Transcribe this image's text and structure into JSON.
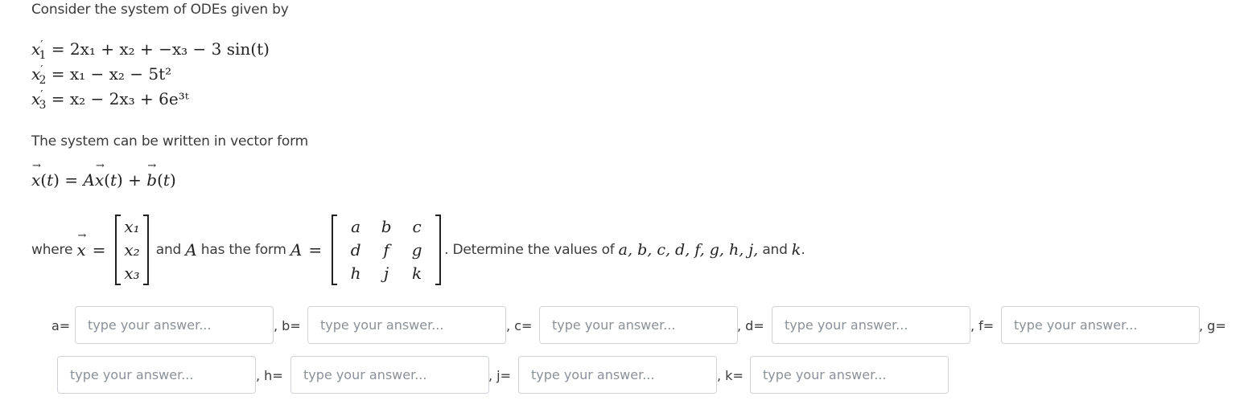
{
  "intro": "Consider the system of ODEs given by",
  "equations": [
    {
      "lhs_var": "x",
      "lhs_sub": "1",
      "rhs": "= 2x₁ + x₂ + −x₃ − 3 sin(t)"
    },
    {
      "lhs_var": "x",
      "lhs_sub": "2",
      "rhs": "= x₁ − x₂ − 5t²"
    },
    {
      "lhs_var": "x",
      "lhs_sub": "3",
      "rhs": "= x₂ − 2x₃ + 6e³ᵗ"
    }
  ],
  "vector_intro": "The system can be written in vector form",
  "vector_equation": "x(t) = Ax(t) + b(t)",
  "where_text": {
    "where": "where",
    "x_vec": "x",
    "equals": "=",
    "x_entries": [
      "x₁",
      "x₂",
      "x₃"
    ],
    "and_text": "and",
    "A": "A",
    "has_form": "has the form",
    "A_entries": [
      [
        "a",
        "b",
        "c"
      ],
      [
        "d",
        "f",
        "g"
      ],
      [
        "h",
        "j",
        "k"
      ]
    ],
    "determine": ". Determine the values of",
    "vars_list": "a, b, c, d, f, g, h, j,",
    "and2": "and",
    "last_var": "k",
    "period": "."
  },
  "answers": {
    "placeholder": "type your answer...",
    "fields": [
      {
        "label": "a=",
        "value": ""
      },
      {
        "label": ", b=",
        "value": ""
      },
      {
        "label": ", c=",
        "value": ""
      },
      {
        "label": ", d=",
        "value": ""
      },
      {
        "label": ", f=",
        "value": ""
      },
      {
        "label": ", g=",
        "value": ""
      },
      {
        "label": ", h=",
        "value": ""
      },
      {
        "label": ", j=",
        "value": ""
      },
      {
        "label": ", k=",
        "value": ""
      }
    ]
  }
}
